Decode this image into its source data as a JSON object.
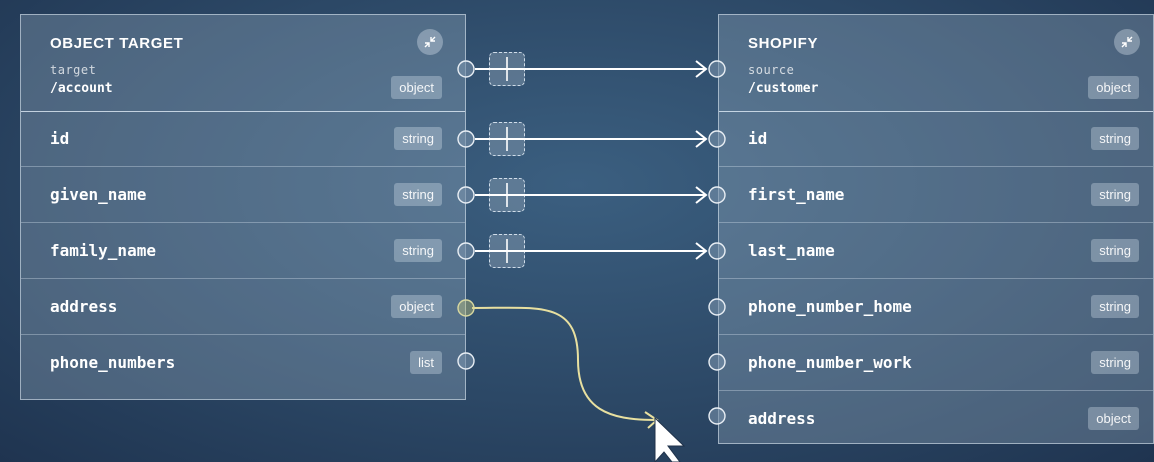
{
  "left": {
    "title": "OBJECT TARGET",
    "sub": "target",
    "path": "/account",
    "type": "object",
    "rows": [
      {
        "name": "id",
        "type": "string"
      },
      {
        "name": "given_name",
        "type": "string"
      },
      {
        "name": "family_name",
        "type": "string"
      },
      {
        "name": "address",
        "type": "object"
      },
      {
        "name": "phone_numbers",
        "type": "list"
      }
    ]
  },
  "right": {
    "title": "SHOPIFY",
    "sub": "source",
    "path": "/customer",
    "type": "object",
    "rows": [
      {
        "name": "id",
        "type": "string"
      },
      {
        "name": "first_name",
        "type": "string"
      },
      {
        "name": "last_name",
        "type": "string"
      },
      {
        "name": "phone_number_home",
        "type": "string"
      },
      {
        "name": "phone_number_work",
        "type": "string"
      },
      {
        "name": "address",
        "type": "object"
      }
    ]
  },
  "colors": {
    "wire": "#ffffff",
    "drag_wire": "#e8e0a0"
  },
  "icons": {
    "collapse": "collapse-arrows-icon",
    "mapper": "add-mapping-icon",
    "cursor": "mouse-pointer-icon"
  }
}
